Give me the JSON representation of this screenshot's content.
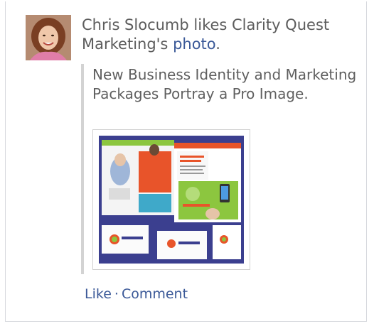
{
  "story": {
    "actor_name": "Chris Slocumb",
    "verb_text": " likes Clarity Quest Marketing's ",
    "object_link": "photo",
    "trailing": "."
  },
  "attachment": {
    "title": "New Business Identity and Marketing Packages Portray a Pro Image."
  },
  "actions": {
    "like": "Like",
    "separator": "·",
    "comment": "Comment"
  },
  "colors": {
    "link": "#3b5998",
    "text": "#5c5c5c",
    "photo_bg": "#3b3f8f",
    "accent_orange": "#e8542a",
    "accent_green": "#8cc63f"
  }
}
